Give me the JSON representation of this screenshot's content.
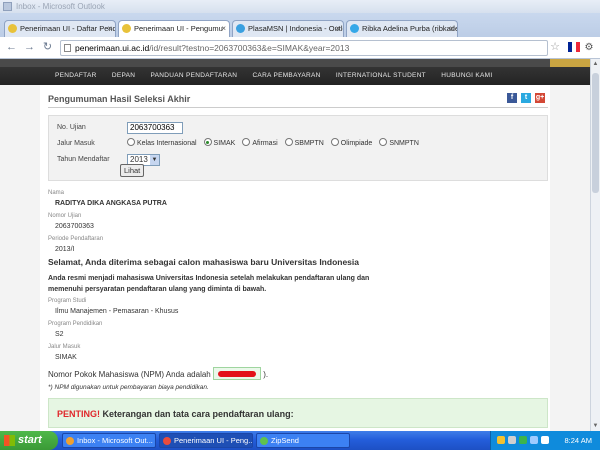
{
  "window": {
    "title": "Inbox - Microsoft Outlook"
  },
  "tabs": [
    {
      "label": "Penerimaan UI - Daftar Pend",
      "close": "×"
    },
    {
      "label": "Penerimaan UI - Pengumu",
      "close": "×"
    },
    {
      "label": "PlasaMSN | Indonesia - Outlo",
      "close": "×"
    },
    {
      "label": "Ribka Adelina Purba (ribkade",
      "close": "×"
    }
  ],
  "address": {
    "host": "penerimaan.ui.ac.id",
    "path": "/id/result?testno=2063700363&e=SIMAK&year=2013"
  },
  "site_nav": [
    "PENDAFTAR",
    "DEPAN",
    "PANDUAN PENDAFTARAN",
    "CARA PEMBAYARAN",
    "INTERNATIONAL STUDENT",
    "HUBUNGI KAMI"
  ],
  "page": {
    "title": "Pengumuman Hasil Seleksi Akhir",
    "social": {
      "facebook": "f",
      "twitter": "t",
      "gplus": "g+"
    }
  },
  "form": {
    "no_ujian_label": "No. Ujian",
    "no_ujian_value": "2063700363",
    "jalur_label": "Jalur Masuk",
    "jalur_options": [
      "Kelas Internasional",
      "SIMAK",
      "Afirmasi",
      "SBMPTN",
      "Olimpiade",
      "SNMPTN"
    ],
    "jalur_selected": "SIMAK",
    "tahun_label": "Tahun Mendaftar",
    "tahun_value": "2013",
    "submit_label": "Lihat"
  },
  "result": {
    "nama_label": "Nama",
    "nama_value": "RADITYA DIKA ANGKASA PUTRA",
    "nomor_label": "Nomor Ujian",
    "nomor_value": "2063700363",
    "periode_label": "Periode Pendaftaran",
    "periode_value": "2013/I",
    "congrats": "Selamat, Anda diterima sebagai calon mahasiswa baru Universitas Indonesia",
    "paragraph": "Anda resmi menjadi mahasiswa Universitas Indonesia setelah melakukan pendaftaran ulang dan memenuhi persyaratan pendaftaran ulang yang diminta di bawah.",
    "prodi_label": "Program Studi",
    "prodi_value": "Ilmu Manajemen - Pemasaran - Khusus",
    "pendidikan_label": "Program Pendidikan",
    "pendidikan_value": "S2",
    "jalur_label": "Jalur Masuk",
    "jalur_value": "SIMAK",
    "npm_prefix": "Nomor Pokok Mahasiswa (NPM) Anda adalah",
    "npm_suffix": ").",
    "note": "*) NPM digunakan untuk pembayaran biaya pendidikan.",
    "penting_red": "PENTING!",
    "penting_text": " Keterangan dan tata cara pendaftaran ulang:"
  },
  "taskbar": {
    "start": "start",
    "tasks": [
      "Inbox - Microsoft Out...",
      "Penerimaan UI - Peng...",
      "ZipSend"
    ],
    "clock": "8:24 AM"
  },
  "colors": {
    "nav_bg": "#2b2b2b",
    "accent_red": "#e0262a",
    "penting_bg": "#e6f6e3",
    "taskbar": "#245edb"
  }
}
